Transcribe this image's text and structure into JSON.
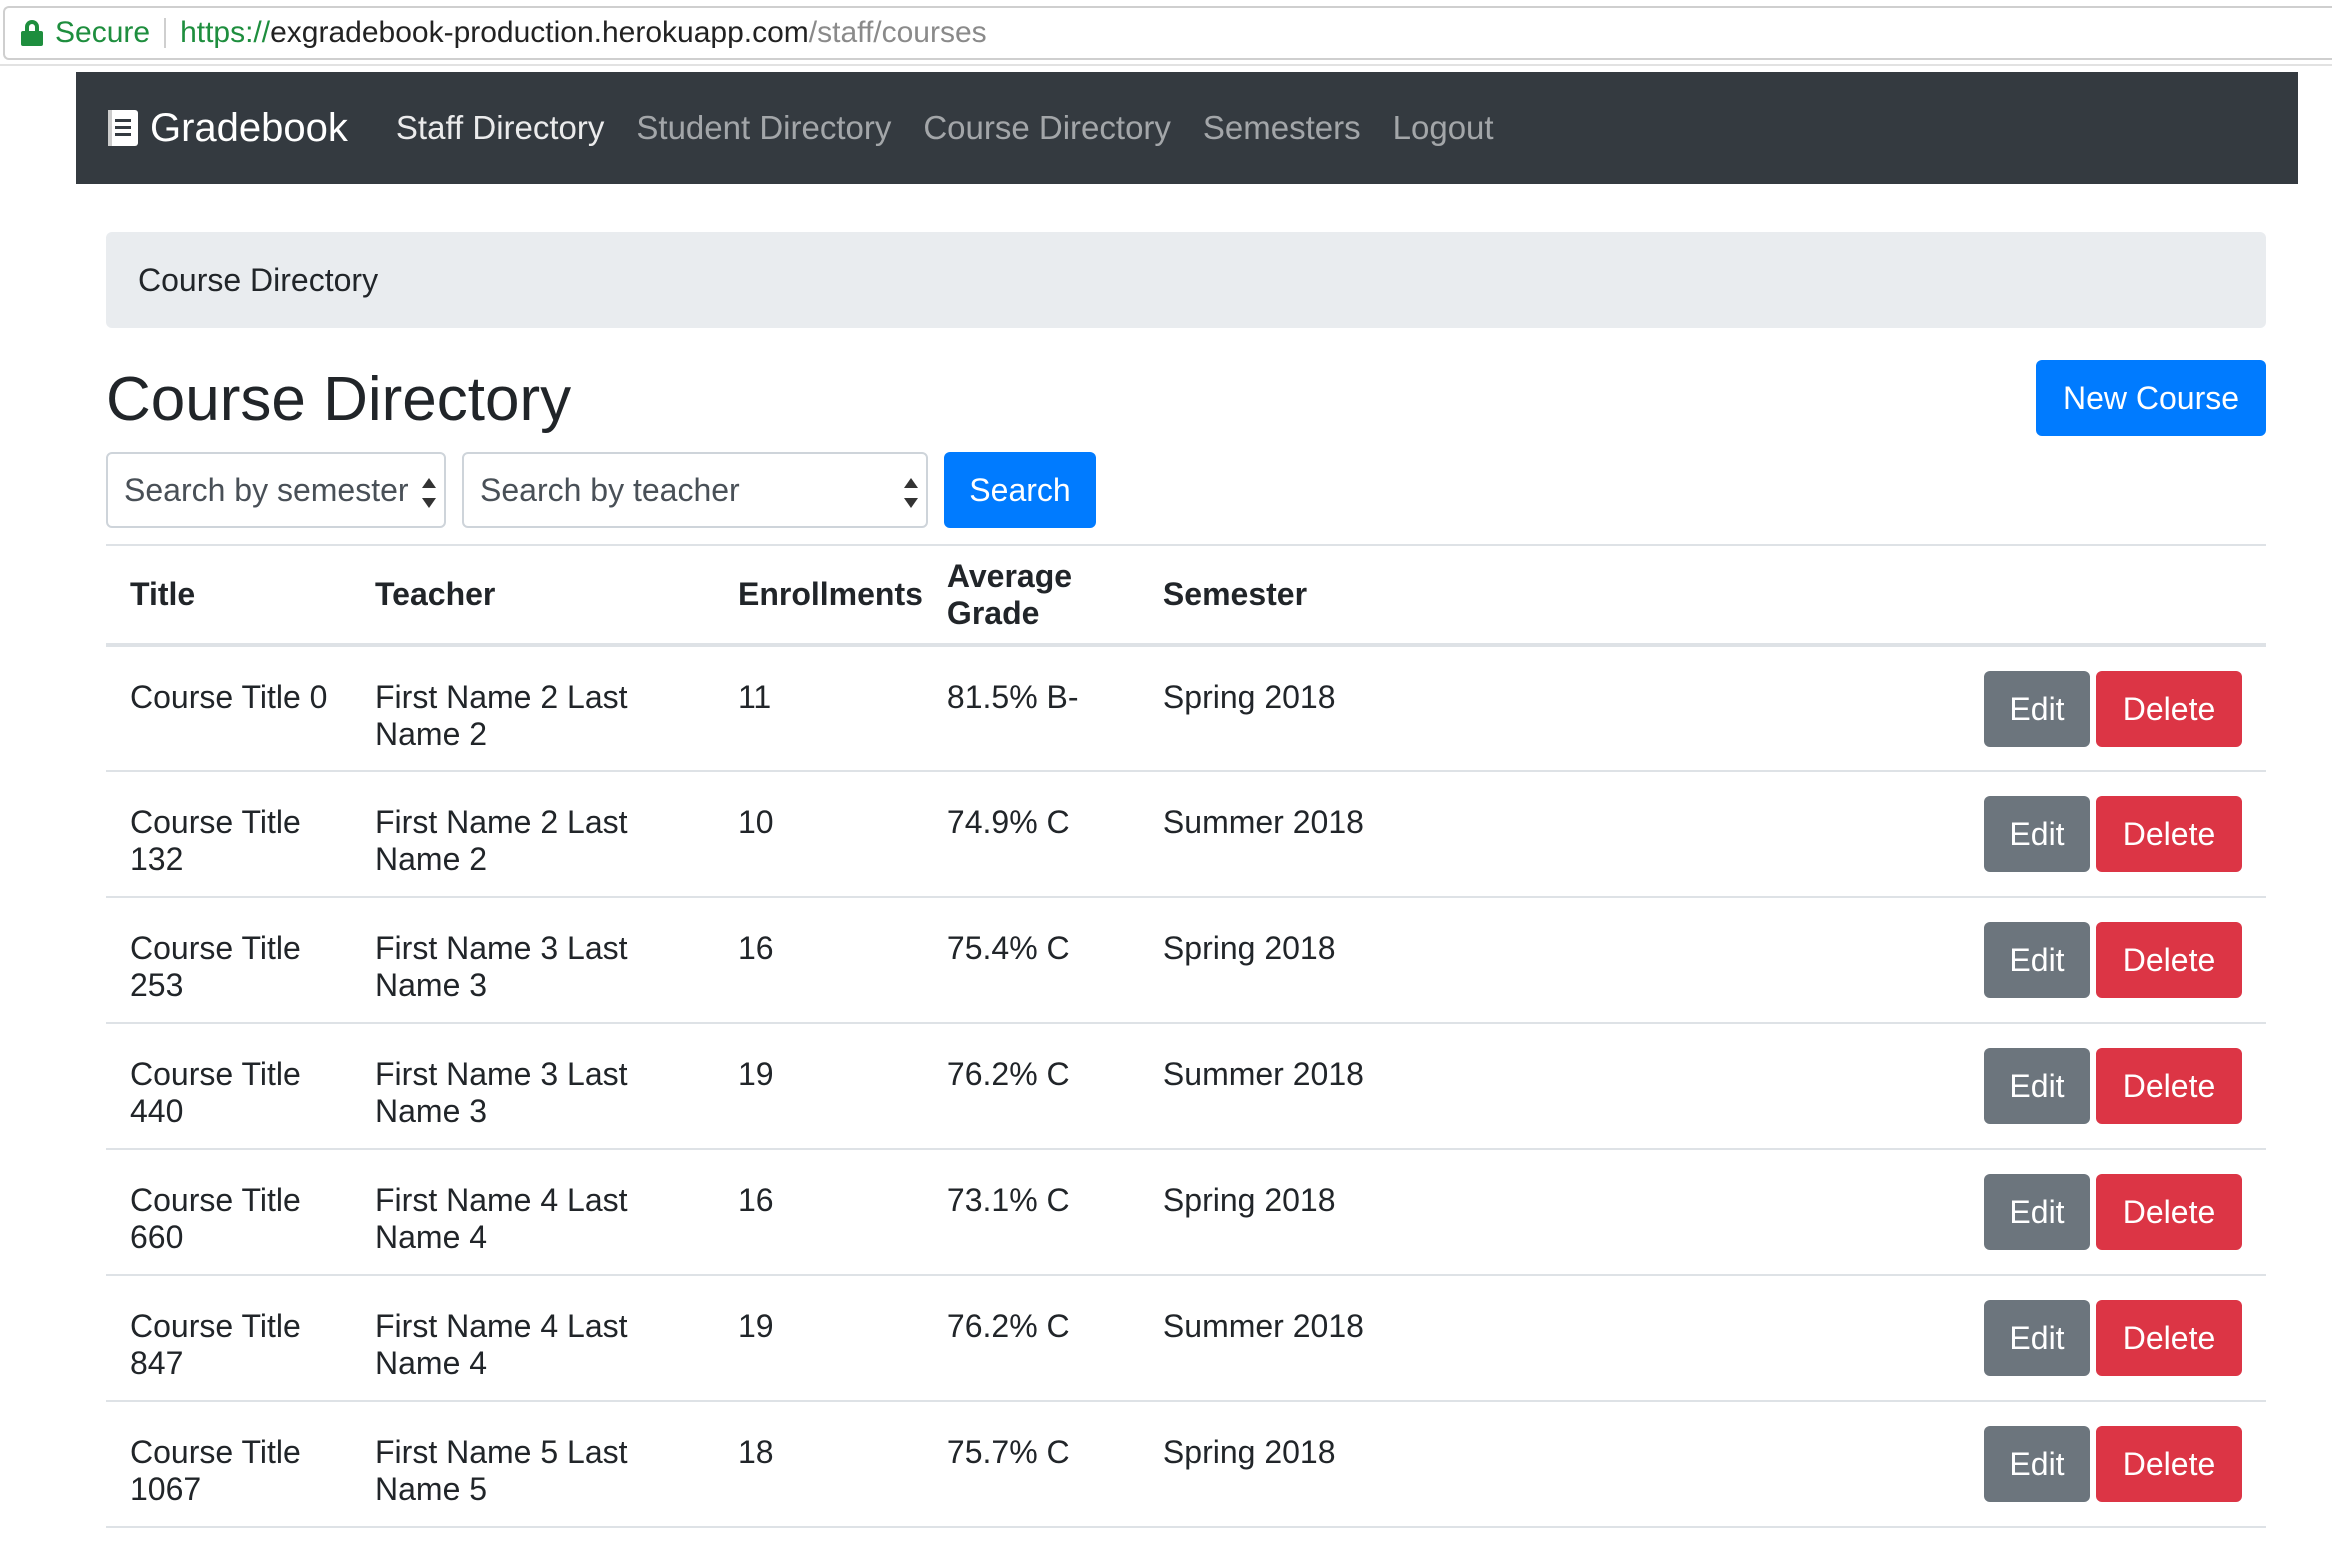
{
  "browser": {
    "secure_label": "Secure",
    "url_scheme": "https://",
    "url_host": "exgradebook-production.herokuapp.com",
    "url_path": "/staff/courses"
  },
  "navbar": {
    "brand": "Gradebook",
    "links": [
      "Staff Directory",
      "Student Directory",
      "Course Directory",
      "Semesters",
      "Logout"
    ]
  },
  "breadcrumb": "Course Directory",
  "page_title": "Course Directory",
  "new_button": "New Course",
  "search": {
    "semester_placeholder": "Search by semester",
    "teacher_placeholder": "Search by teacher",
    "button": "Search"
  },
  "table": {
    "headers": [
      "Title",
      "Teacher",
      "Enrollments",
      "Average Grade",
      "Semester"
    ],
    "edit_label": "Edit",
    "delete_label": "Delete",
    "rows": [
      {
        "title": "Course Title 0",
        "teacher": "First Name 2 Last Name 2",
        "enrollments": "11",
        "grade": "81.5% B-",
        "semester": "Spring 2018"
      },
      {
        "title": "Course Title 132",
        "teacher": "First Name 2 Last Name 2",
        "enrollments": "10",
        "grade": "74.9% C",
        "semester": "Summer 2018"
      },
      {
        "title": "Course Title 253",
        "teacher": "First Name 3 Last Name 3",
        "enrollments": "16",
        "grade": "75.4% C",
        "semester": "Spring 2018"
      },
      {
        "title": "Course Title 440",
        "teacher": "First Name 3 Last Name 3",
        "enrollments": "19",
        "grade": "76.2% C",
        "semester": "Summer 2018"
      },
      {
        "title": "Course Title 660",
        "teacher": "First Name 4 Last Name 4",
        "enrollments": "16",
        "grade": "73.1% C",
        "semester": "Spring 2018"
      },
      {
        "title": "Course Title 847",
        "teacher": "First Name 4 Last Name 4",
        "enrollments": "19",
        "grade": "76.2% C",
        "semester": "Summer 2018"
      },
      {
        "title": "Course Title 1067",
        "teacher": "First Name 5 Last Name 5",
        "enrollments": "18",
        "grade": "75.7% C",
        "semester": "Spring 2018"
      }
    ]
  },
  "colors": {
    "navbar": "#343a40",
    "primary": "#007bff",
    "secondary": "#6c757d",
    "danger": "#dc3545",
    "breadcrumb_bg": "#e9ecef",
    "secure_green": "#1e8e3e"
  }
}
